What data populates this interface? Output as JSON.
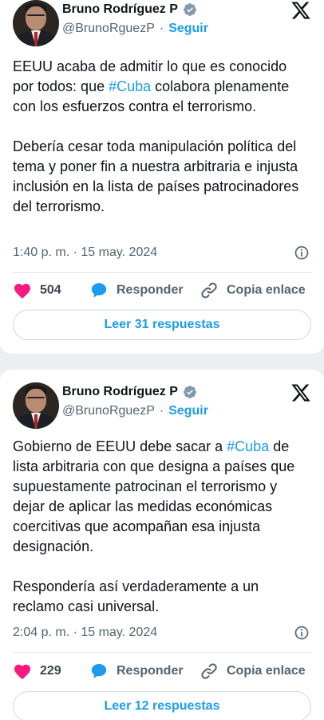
{
  "tweets": [
    {
      "author_name": "Bruno Rodríguez P",
      "handle": "@BrunoRguezP",
      "separator": "·",
      "follow_label": "Seguir",
      "text_parts_p1": [
        "EEUU acaba de admitir lo que es conocido por todos: que ",
        "#Cuba",
        " colabora plenamente con los esfuerzos contra el terrorismo."
      ],
      "paragraph2": "Debería cesar toda manipulación política del tema y poner fin a nuestra arbitraria e injusta inclusión en la lista de países patrocinadores del terrorismo.",
      "timestamp": "1:40 p. m. · 15 may. 2024",
      "likes": "504",
      "reply_label": "Responder",
      "copy_label": "Copia enlace",
      "read_replies": "Leer 31 respuestas"
    },
    {
      "author_name": "Bruno Rodríguez P",
      "handle": "@BrunoRguezP",
      "separator": "·",
      "follow_label": "Seguir",
      "text_parts_p1": [
        "Gobierno de EEUU debe sacar a ",
        "#Cuba",
        " de lista arbitraria con que designa a países que supuestamente patrocinan el terrorismo y dejar de aplicar las medidas económicas coercitivas que acompañan esa injusta designación."
      ],
      "paragraph2": "Respondería así  verdaderamente a un reclamo casi universal.",
      "timestamp": "2:04 p. m. · 15 may. 2024",
      "likes": "229",
      "reply_label": "Responder",
      "copy_label": "Copia enlace",
      "read_replies": "Leer 12 respuestas"
    }
  ],
  "colors": {
    "accent": "#1d9bf0",
    "like": "#f91880",
    "text": "#0f1419",
    "muted": "#536471",
    "page_bg": "#eceeef"
  },
  "icons": [
    "verified-badge-icon",
    "x-logo-icon",
    "info-icon",
    "heart-icon",
    "reply-bubble-icon",
    "link-icon"
  ]
}
